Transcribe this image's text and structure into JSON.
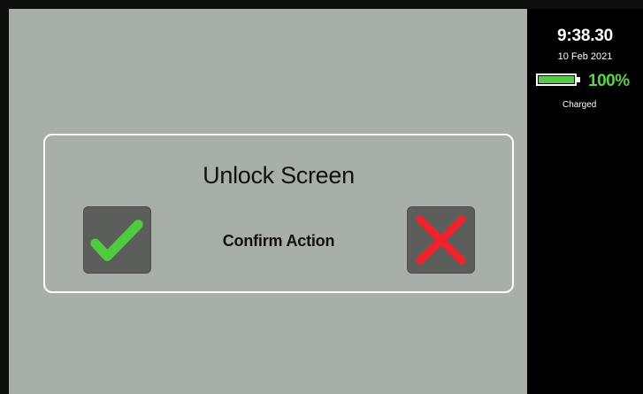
{
  "status": {
    "time": "9:38.30",
    "date": "10 Feb 2021",
    "battery_percent": "100%",
    "battery_level": 1.0,
    "charge_status": "Charged",
    "battery_fill_color": "#57c84a",
    "battery_text_color": "#5fd14f"
  },
  "dialog": {
    "title": "Unlock Screen",
    "confirm_label": "Confirm Action",
    "confirm_icon": "checkmark-icon",
    "cancel_icon": "x-icon",
    "confirm_color": "#4fcb3f",
    "cancel_color": "#f0232c"
  },
  "colors": {
    "screen_background": "#a8aea8",
    "status_background": "#000000",
    "button_background": "#5c5e5c",
    "dialog_border": "#ffffff"
  }
}
